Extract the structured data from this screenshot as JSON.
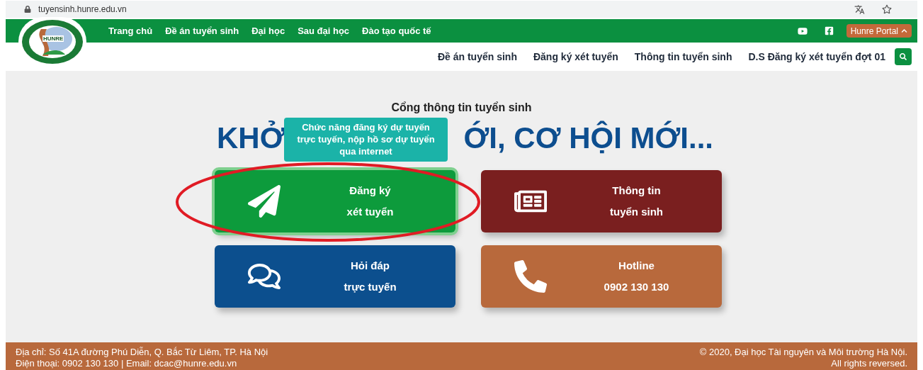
{
  "browser": {
    "url": "tuyensinh.hunre.edu.vn"
  },
  "logo": {
    "text": "HUNRE"
  },
  "top_nav": [
    {
      "label": "Trang chủ"
    },
    {
      "label": "Đề án tuyển sinh"
    },
    {
      "label": "Đại học"
    },
    {
      "label": "Sau đại học"
    },
    {
      "label": "Đào tạo quốc tế"
    }
  ],
  "portal_button": {
    "label": "Hunre Portal"
  },
  "sub_nav": [
    {
      "label": "Đề án tuyển sinh"
    },
    {
      "label": "Đăng ký xét tuyển"
    },
    {
      "label": "Thông tin tuyển sinh"
    },
    {
      "label": "D.S Đăng ký xét tuyển đợt 01"
    }
  ],
  "main": {
    "title": "Cổng thông tin tuyển sinh",
    "headline_start": "KHỞ",
    "headline_end": "ỚI, CƠ HỘI MỚI...",
    "tooltip": "Chức năng đăng ký dự tuyến trực tuyến, nộp hồ sơ dự tuyển qua internet",
    "tiles": [
      {
        "kind": "send",
        "color": "#0d9b3c",
        "line1": "Đăng ký",
        "line2": "xét tuyển",
        "highlighted": true
      },
      {
        "kind": "news",
        "color": "#7a1f1f",
        "line1": "Thông tin",
        "line2": "tuyển sinh",
        "highlighted": false
      },
      {
        "kind": "chat",
        "color": "#0c4f8e",
        "line1": "Hỏi đáp",
        "line2": "trực tuyến",
        "highlighted": false
      },
      {
        "kind": "phone",
        "color": "#b8693c",
        "line1": "Hotline",
        "line2": "0902 130 130",
        "highlighted": false
      }
    ]
  },
  "footer": {
    "address": "Địa chỉ: Số 41A đường Phú Diễn, Q. Bắc Từ Liêm, TP. Hà Nội",
    "contact": "Điện thoại: 0902 130 130 | Email: dcac@hunre.edu.vn",
    "copyright": "© 2020, Đại học Tài nguyên và Môi trường Hà Nội.",
    "rights": "All rights reversed."
  }
}
